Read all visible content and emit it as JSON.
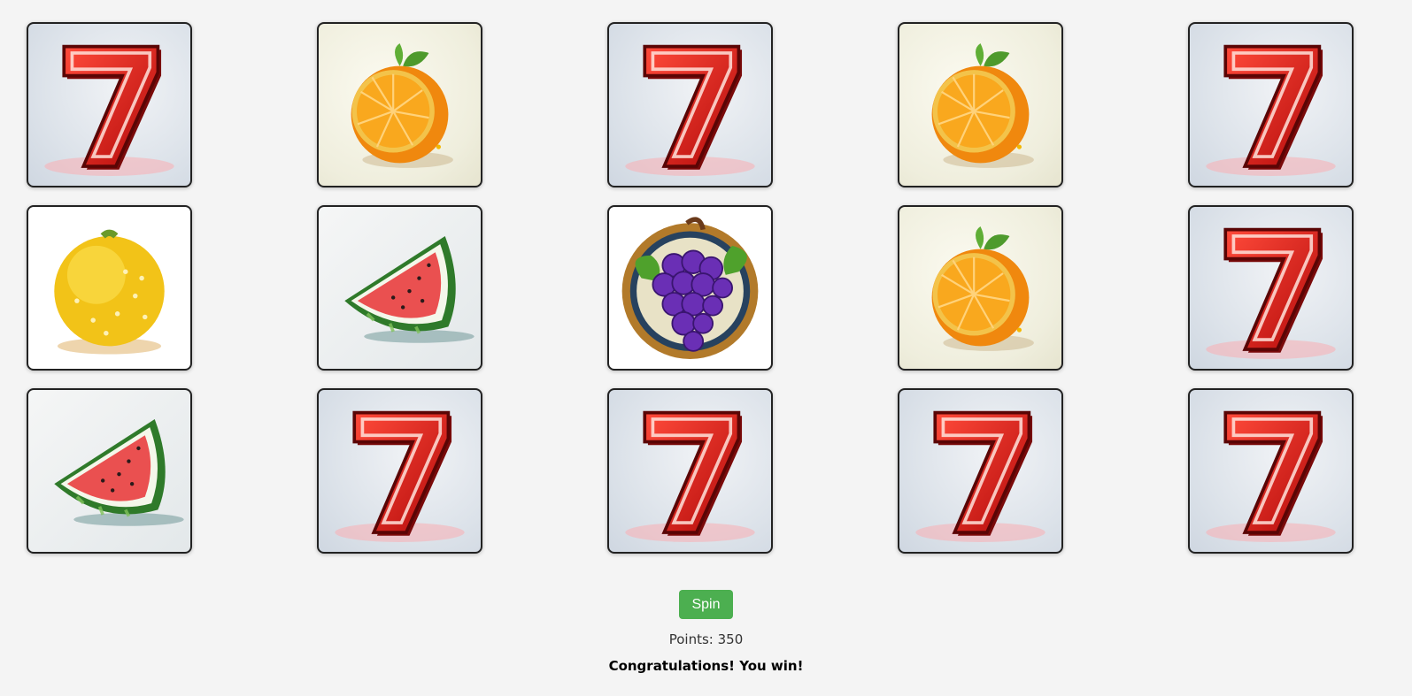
{
  "slot_grid": {
    "rows": [
      [
        "seven",
        "orange",
        "seven",
        "orange",
        "seven"
      ],
      [
        "lemon",
        "watermelon",
        "grapes",
        "orange",
        "seven"
      ],
      [
        "watermelon",
        "seven",
        "seven",
        "seven",
        "seven"
      ]
    ]
  },
  "symbols": {
    "seven": {
      "icon": "seven-icon",
      "color": "#d41818"
    },
    "orange": {
      "icon": "orange-icon",
      "color": "#f58a12"
    },
    "lemon": {
      "icon": "lemon-icon",
      "color": "#f2c318"
    },
    "watermelon": {
      "icon": "watermelon-icon",
      "color": "#e84848"
    },
    "grapes": {
      "icon": "grapes-icon",
      "color": "#6a2fb5"
    }
  },
  "controls": {
    "spin_label": "Spin",
    "spin_color": "#4caf50",
    "points_text": "Points: 350",
    "message_text": "Congratulations! You win!"
  }
}
